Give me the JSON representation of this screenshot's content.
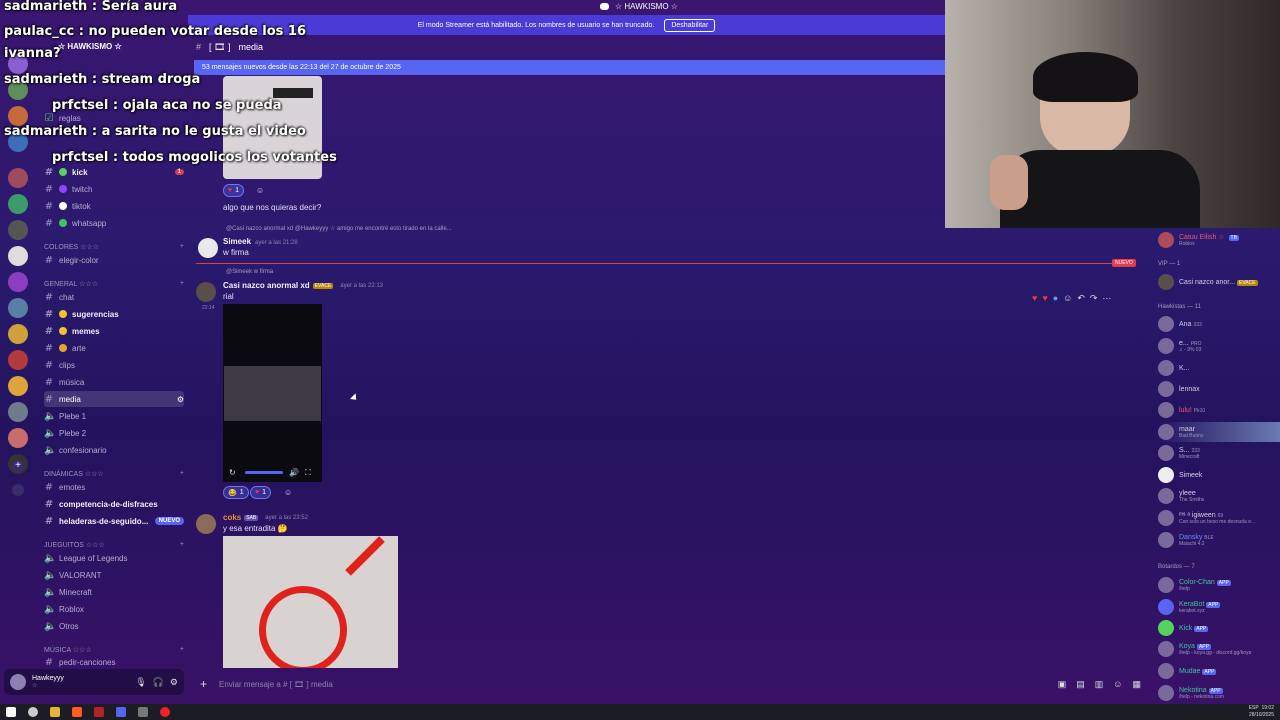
{
  "window": {
    "title": "☆ HAWKISMO ☆"
  },
  "server": {
    "name": "☆ HAWKISMO ☆"
  },
  "streamer_banner": {
    "text": "El modo Streamer está habilitado. Los nombres de usuario se han truncado.",
    "button": "Deshabilitar"
  },
  "channel_header": {
    "name": "media",
    "prefix": "[ 🎞 ]"
  },
  "new_messages": {
    "text": "53 mensajes nuevos desde las 22:13 del 27 de octubre de 2025"
  },
  "channels_top": [
    {
      "label": "reglas"
    },
    {
      "label": "kick",
      "badge": "1"
    },
    {
      "label": "twitch"
    },
    {
      "label": "tiktok"
    },
    {
      "label": "whatsapp"
    }
  ],
  "categories": {
    "colores": "COLORES ☆☆☆",
    "general": "GENERAL ☆☆☆",
    "dinamicas": "DINÁMICAS ☆☆☆",
    "juegitos": "JUEGUITOS ☆☆☆",
    "musica": "MÚSICA ☆☆☆"
  },
  "channels_colores": [
    {
      "label": "elegir-color"
    }
  ],
  "channels_general": [
    {
      "label": "chat"
    },
    {
      "label": "sugerencias"
    },
    {
      "label": "memes"
    },
    {
      "label": "arte"
    },
    {
      "label": "clips"
    },
    {
      "label": "música"
    },
    {
      "label": "media"
    },
    {
      "label": "Plebe 1"
    },
    {
      "label": "Plebe 2"
    },
    {
      "label": "confesionario"
    }
  ],
  "channels_dinamicas": [
    {
      "label": "emotes"
    },
    {
      "label": "competencia-de-disfraces"
    },
    {
      "label": "heladeras-de-seguido...",
      "badge": "NUEVO"
    }
  ],
  "channels_juegitos": [
    {
      "label": "League of Legends"
    },
    {
      "label": "VALORANT"
    },
    {
      "label": "Minecraft"
    },
    {
      "label": "Roblox"
    },
    {
      "label": "Otros"
    }
  ],
  "channels_musica": [
    {
      "label": "pedir-canciones"
    }
  ],
  "user": {
    "name": "Hawkeyyy",
    "status": "☆"
  },
  "messages": {
    "m0": {
      "text": "algo que nos quieras decir?",
      "react_count": "1"
    },
    "m1": {
      "reply": "@Casi nazco anormal xd  @Hawkeyyy ☆ amigo me encontré esto tirado en la calle...",
      "user": "Simeek",
      "time": "ayer a las 21:28",
      "text": "w firma"
    },
    "new_divider": "NUEVO",
    "m2": {
      "reply": "@Simeek w firma",
      "user": "Casi nazco anormal xd",
      "tag": "EVACE",
      "time": "ayer a las 22:13",
      "side_time": "22:14",
      "text": "rial",
      "react_a": "1",
      "react_b": "1"
    },
    "m3": {
      "user": "coks",
      "tag": "SAB",
      "time": "ayer a las 23:52",
      "text": "y esa entradita 🤔"
    }
  },
  "input": {
    "placeholder": "Enviar mensaje a # [ 🎞 ] media"
  },
  "members": {
    "top_user": {
      "name": "Catuu Eilish ☆",
      "tag": "TB",
      "sub": "Roblox"
    },
    "vip_header": "VIP — 1",
    "vip": [
      {
        "name": "Casi nazco anor...",
        "tag": "EVACE"
      }
    ],
    "hawkistas_header": "Hawkistas — 11",
    "hawkistas": [
      {
        "name": "Ana",
        "tag": "333",
        "sub": ""
      },
      {
        "name": "e...",
        "tag": "PRO",
        "sub": "♫ - 9% 03"
      },
      {
        "name": "K...",
        "tag": "",
        "sub": ""
      },
      {
        "name": "lennax",
        "tag": "",
        "sub": ""
      },
      {
        "name": "lulu!",
        "tag": "Pk10",
        "sub": ""
      },
      {
        "name": "maar",
        "tag": "",
        "sub": "Bad Bunny"
      },
      {
        "name": "S...",
        "tag": "333",
        "sub": "Minecraft"
      },
      {
        "name": "Simeek",
        "tag": "",
        "sub": ""
      },
      {
        "name": "yleee",
        "tag": "",
        "sub": "The Smiths"
      },
      {
        "name": "ᵐˢ ᵃ igiween",
        "tag": "69",
        "sub": "Con solo un beso me desnuda e..."
      },
      {
        "name": "Dansky",
        "tag": "BLE",
        "sub": "Malachi 4:2"
      }
    ],
    "bots_header": "Botardos — 7",
    "bots": [
      {
        "name": "Color-Chan",
        "sub": "/help"
      },
      {
        "name": "KeraBot",
        "sub": "kerabot.xyz"
      },
      {
        "name": "Kick",
        "sub": ""
      },
      {
        "name": "Koya",
        "sub": "/help - koya.gg - discord.gg/koya"
      },
      {
        "name": "Mudae",
        "sub": ""
      },
      {
        "name": "Nekotina",
        "sub": "/help - nekotina.com"
      }
    ],
    "app_tag": "APP"
  },
  "chat_overlay": [
    {
      "user": "sadmarieth",
      "text": "Sería aura"
    },
    {
      "user": "paulac_cc",
      "text": "no pueden votar desde los 16"
    },
    {
      "user": "",
      "text": "ivanna?"
    },
    {
      "user": "sadmarieth",
      "text": "stream droga"
    },
    {
      "user": "prfctsel",
      "text": "ojala aca no se pueda"
    },
    {
      "user": "sadmarieth",
      "text": "a sarita no le gusta el video"
    },
    {
      "user": "prfctsel",
      "text": "todos mogolicos los votantes"
    }
  ],
  "taskbar": {
    "time": "19:02",
    "date": "28/10/2025",
    "lang": "ESP"
  },
  "colors": {
    "accent": "#5865f2",
    "red": "#e23b4a",
    "bg_top": "#3a1670"
  }
}
